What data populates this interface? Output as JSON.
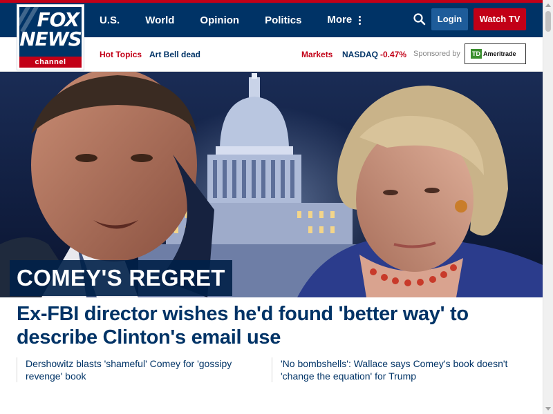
{
  "brand": {
    "logo_line1": "FOX",
    "logo_line2": "NEWS",
    "logo_line3": "channel"
  },
  "nav": {
    "items": [
      {
        "label": "U.S."
      },
      {
        "label": "World"
      },
      {
        "label": "Opinion"
      },
      {
        "label": "Politics"
      },
      {
        "label": "More"
      }
    ],
    "login_label": "Login",
    "watch_label": "Watch TV"
  },
  "subnav": {
    "hot_topics_label": "Hot Topics",
    "topic_link": "Art Bell dead",
    "markets_label": "Markets",
    "index_name": "NASDAQ",
    "index_change": "-0.47%",
    "sponsored_label": "Sponsored by",
    "sponsor_badge": "TD",
    "sponsor_name": "Ameritrade"
  },
  "hero": {
    "label": "COMEY'S REGRET",
    "headline": "Ex-FBI director wishes he'd found 'better way' to describe Clinton's email use"
  },
  "related": [
    {
      "text": "Dershowitz blasts 'shameful' Comey for 'gossipy revenge' book"
    },
    {
      "text": "'No bombshells': Wallace says Comey's book doesn't 'change the equation' for Trump"
    }
  ],
  "colors": {
    "navy": "#003366",
    "red": "#c20017",
    "login_blue": "#1e5c9a"
  }
}
